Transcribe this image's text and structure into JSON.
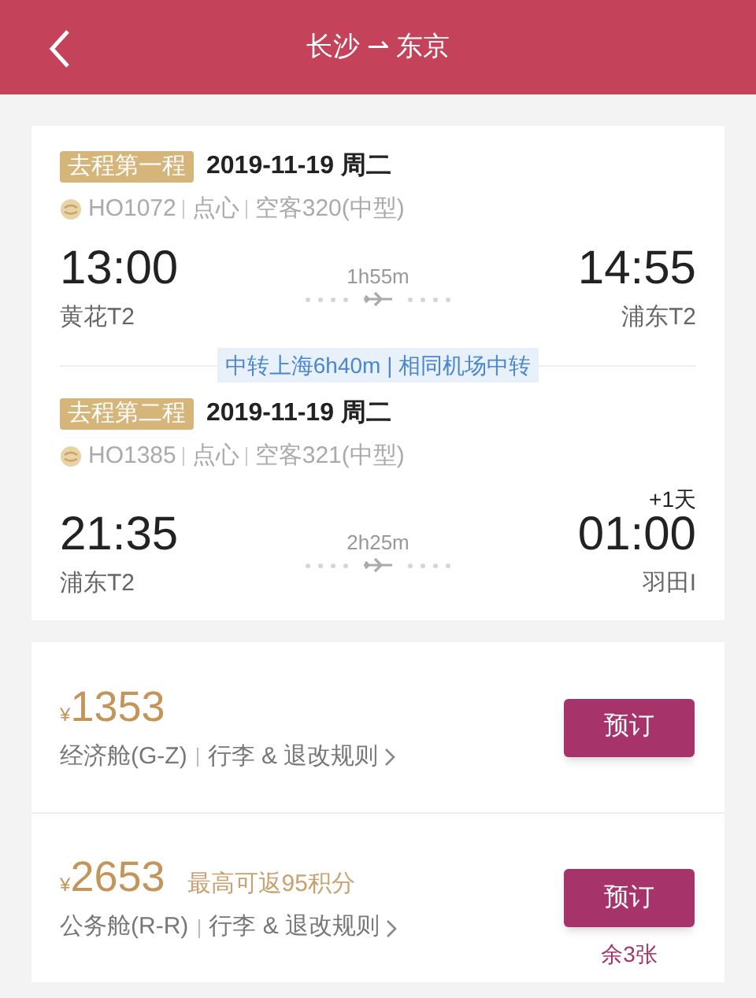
{
  "header": {
    "title": "长沙 ⇀ 东京"
  },
  "segments": [
    {
      "tag": "去程第一程",
      "date": "2019-11-19 周二",
      "info": [
        "HO1072",
        "点心",
        "空客320(中型)"
      ],
      "dep_time": "13:00",
      "dep_airport": "黄花T2",
      "duration": "1h55m",
      "arr_time": "14:55",
      "arr_airport": "浦东T2"
    },
    {
      "tag": "去程第二程",
      "date": "2019-11-19 周二",
      "info": [
        "HO1385",
        "点心",
        "空客321(中型)"
      ],
      "dep_time": "21:35",
      "dep_airport": "浦东T2",
      "duration": "2h25m",
      "arr_time": "01:00",
      "arr_airport": "羽田I",
      "day_offset": "+1天"
    }
  ],
  "transfer": "中转上海6h40m | 相同机场中转",
  "fares": [
    {
      "currency": "¥",
      "price": "1353",
      "cabin": "经济舱(G-Z)",
      "rules": "行李 & 退改规则",
      "button": "预订"
    },
    {
      "currency": "¥",
      "price": "2653",
      "points": "最高可返95积分",
      "cabin": "公务舱(R-R)",
      "rules": "行李 & 退改规则",
      "button": "预订",
      "remaining": "余3张"
    }
  ]
}
